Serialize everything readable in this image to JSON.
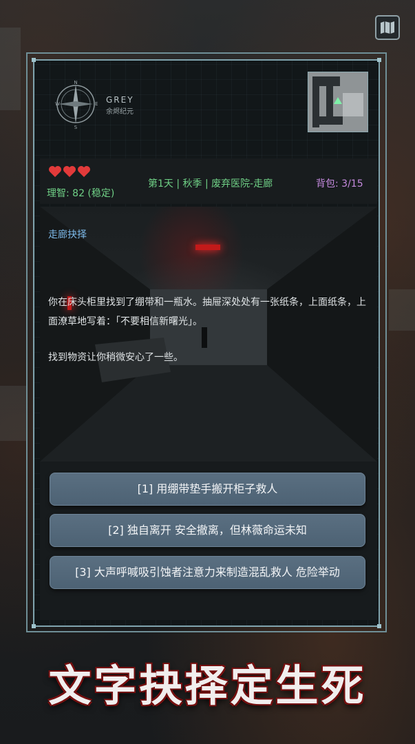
{
  "brand": {
    "name_en": "GREY",
    "name_cn": "余烬纪元"
  },
  "status": {
    "hearts": 3,
    "sanity": "理智: 82 (稳定)",
    "day_info": "第1天 | 秋季 | 废弃医院-走廊",
    "bag": "背包: 3/15"
  },
  "colors": {
    "sanity": "#6fd086",
    "bag": "#c58adf",
    "heart": "#e23a3a",
    "title": "#7bb7e6"
  },
  "scene": {
    "title": "走廊抉择",
    "paragraph1": "你在床头柜里找到了绷带和一瓶水。抽屉深处处有一张纸条，上面纸条，上面潦草地写着：「不要相信新曙光」。",
    "paragraph2": "找到物资让你稍微安心了一些。"
  },
  "choices": [
    {
      "label": "[1] 用绷带垫手搬开柜子救人"
    },
    {
      "label": "[2] 独自离开  安全撤离，但林薇命运未知"
    },
    {
      "label": "[3] 大声呼喊吸引蚀者注意力来制造混乱救人  危险举动"
    }
  ],
  "slogan": "文字抉择定生死",
  "icons": {
    "map": "map-icon",
    "compass": "compass-icon",
    "heart": "heart-icon",
    "player": "player-arrow-icon"
  }
}
